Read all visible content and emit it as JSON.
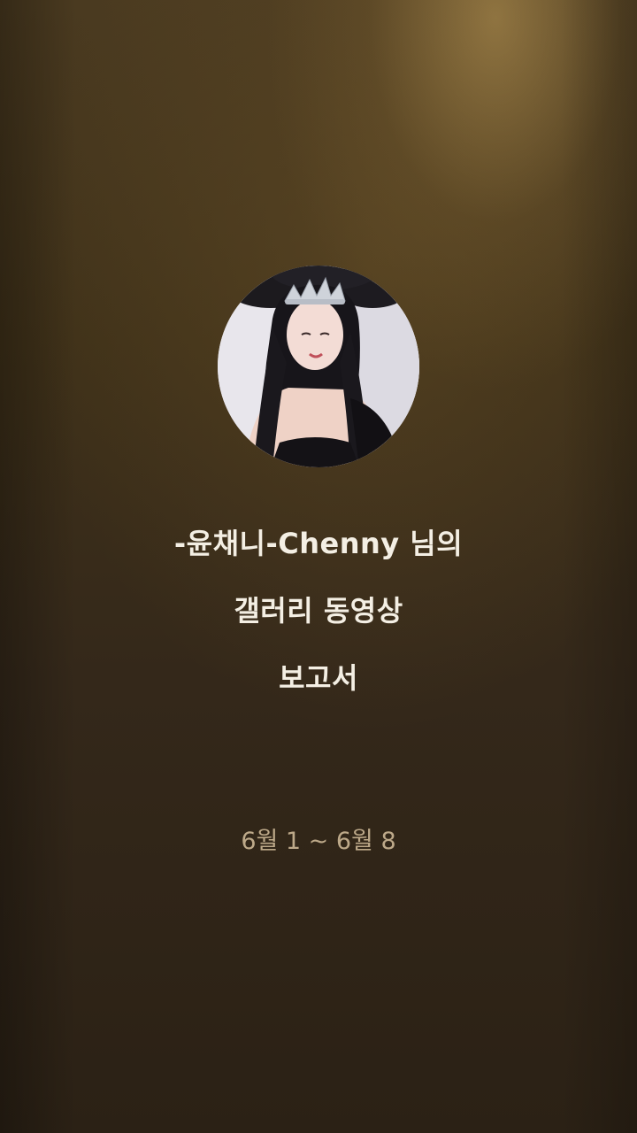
{
  "report": {
    "title_line1": "-윤채니-Chenny 님의",
    "title_line2": "갤러리 동영상",
    "title_line3": "보고서",
    "date_range": "6월 1 ~ 6월 8"
  },
  "profile": {
    "avatar_icon": "profile-photo-icon"
  },
  "colors": {
    "background_top": "#4a3a20",
    "background_bottom": "#2b2115",
    "highlight": "#c4a05a",
    "title_text": "#f4efe4",
    "date_text": "#bda989"
  }
}
